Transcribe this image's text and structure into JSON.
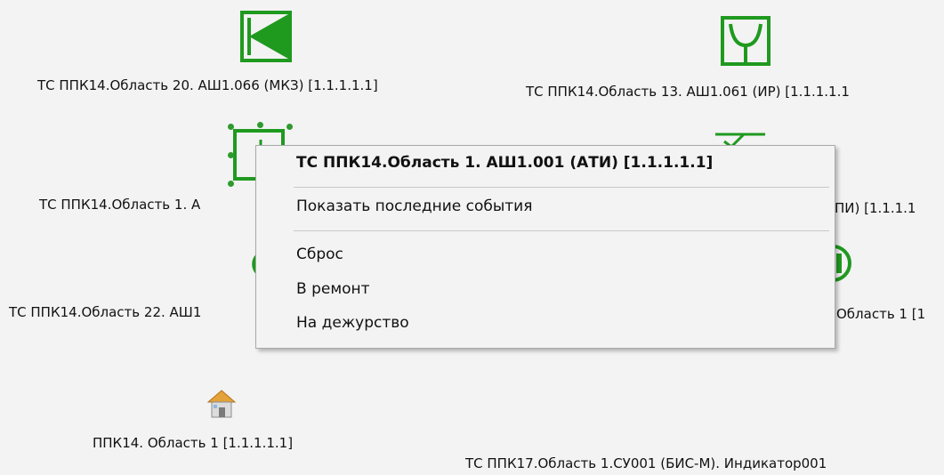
{
  "colors": {
    "icon_green": "#1f9a1f",
    "canvas_bg": "#f3f3f3",
    "menu_bg": "#f3f3f3",
    "menu_border": "#a9a9a9"
  },
  "canvas": {
    "labels": {
      "mkz": "ТС ППК14.Область 20. АШ1.066 (МКЗ) [1.1.1.1.1]",
      "ir": "ТС ППК14.Область 13. АШ1.061 (ИР) [1.1.1.1.1",
      "ati_partial": "ТС ППК14.Область 1. А",
      "right_mid_partial": "ПИ) [1.1.1.1",
      "area22_partial": "ТС ППК14.Область 22. АШ1",
      "right_area1_partial": "Область 1 [1",
      "area_ppk14": "ППК14. Область 1 [1.1.1.1.1]",
      "ppk17": "ТС ППК17.Область 1.СУ001 (БИС-М). Индикатор001"
    },
    "icons": [
      "mkz-device-icon",
      "ir-device-icon",
      "ati-device-icon",
      "checkmark-device-icon",
      "circle-device-icon",
      "house-area-icon"
    ]
  },
  "context_menu": {
    "title": "ТС ППК14.Область 1. АШ1.001 (АТИ) [1.1.1.1.1]",
    "items": [
      "Показать последние события",
      "Сброс",
      "В ремонт",
      "На дежурство"
    ]
  }
}
